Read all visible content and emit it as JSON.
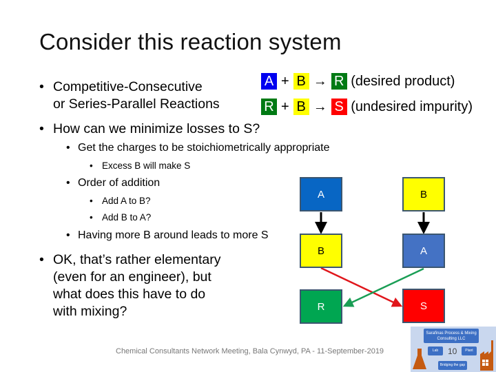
{
  "slide": {
    "title": "Consider this reaction system",
    "bullets": {
      "competitive_line1": "Competitive-Consecutive",
      "competitive_line2": "or Series-Parallel Reactions",
      "minimize": "How can we minimize losses to S?",
      "charges": "Get the charges to be stoichiometrically appropriate",
      "excess": "Excess B will make S",
      "order": "Order of addition",
      "add_a_to_b": "Add A to B?",
      "add_b_to_a": "Add B to A?",
      "having_more_b": "Having more B around leads to more S",
      "ok_line1": "OK, that’s rather elementary",
      "ok_line2": "(even for an engineer), but",
      "ok_line3": "what does this have to do",
      "ok_line4": "with mixing?"
    },
    "reactions": [
      {
        "reactant1": "A",
        "plus": "+",
        "reactant2": "B",
        "arrow": "→",
        "product": "R",
        "note": "(desired product)"
      },
      {
        "reactant1": "R",
        "plus": "+",
        "reactant2": "B",
        "arrow": "→",
        "product": "S",
        "note": "(undesired impurity)"
      }
    ],
    "diagram": {
      "left_column": [
        "A",
        "B",
        "R"
      ],
      "right_column": [
        "B",
        "A",
        "S"
      ],
      "colors": {
        "A_left": "#0866c4",
        "A_right": "#4472c4",
        "B": "#ffff00",
        "R": "#00a651",
        "S": "#ff0000",
        "arrow_black": "#000000",
        "arrow_red": "#e0161b",
        "arrow_green": "#1a9e55"
      }
    },
    "footer": "Chemical Consultants Network Meeting, Bala Cynwyd, PA - 11-September-2019",
    "page_number": "10",
    "logo": {
      "company": "Sarafinas Process & Mixing Consulting LLC",
      "lab": "Lab",
      "plant": "Plant",
      "tagline": "Bridging the gap"
    }
  }
}
